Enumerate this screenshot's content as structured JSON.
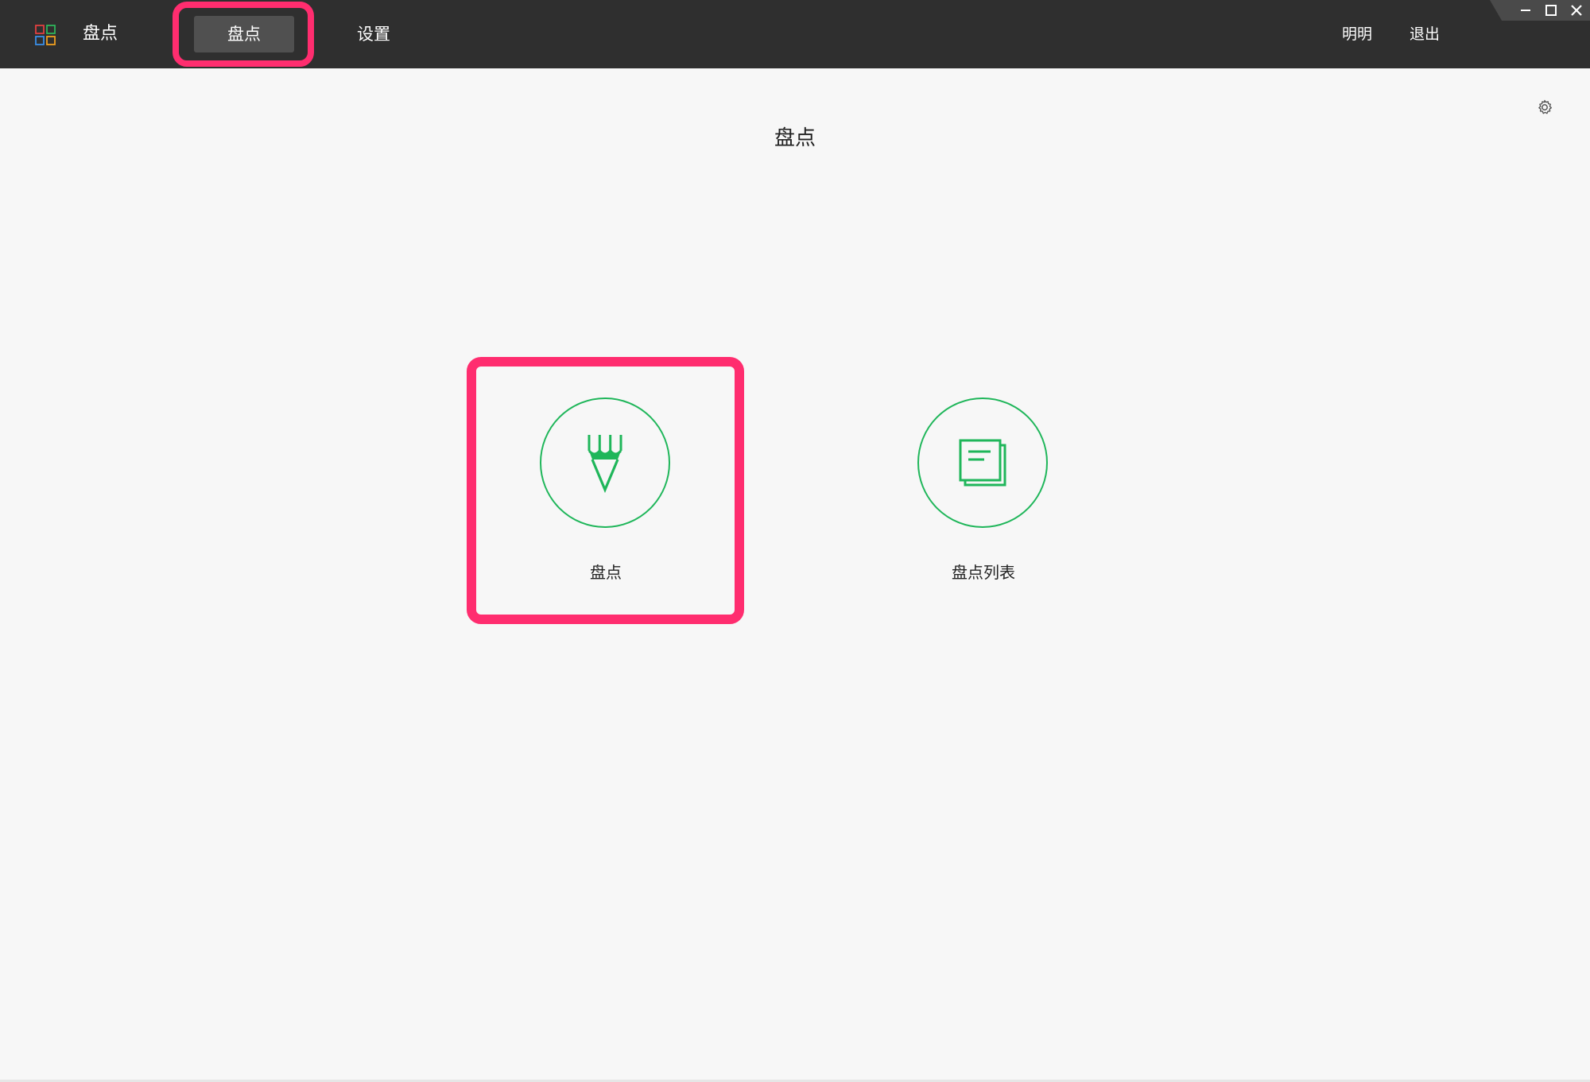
{
  "header": {
    "app_title": "盘点",
    "tabs": [
      {
        "label": "盘点",
        "active": true
      },
      {
        "label": "设置",
        "active": false
      }
    ],
    "user_name": "明明",
    "logout_label": "退出"
  },
  "main": {
    "page_title": "盘点",
    "cards": [
      {
        "label": "盘点",
        "icon": "pencil-icon"
      },
      {
        "label": "盘点列表",
        "icon": "document-list-icon"
      }
    ]
  },
  "colors": {
    "topbar": "#2f2f2f",
    "accent_green": "#1fb65a",
    "highlight": "#ff2d6f"
  }
}
